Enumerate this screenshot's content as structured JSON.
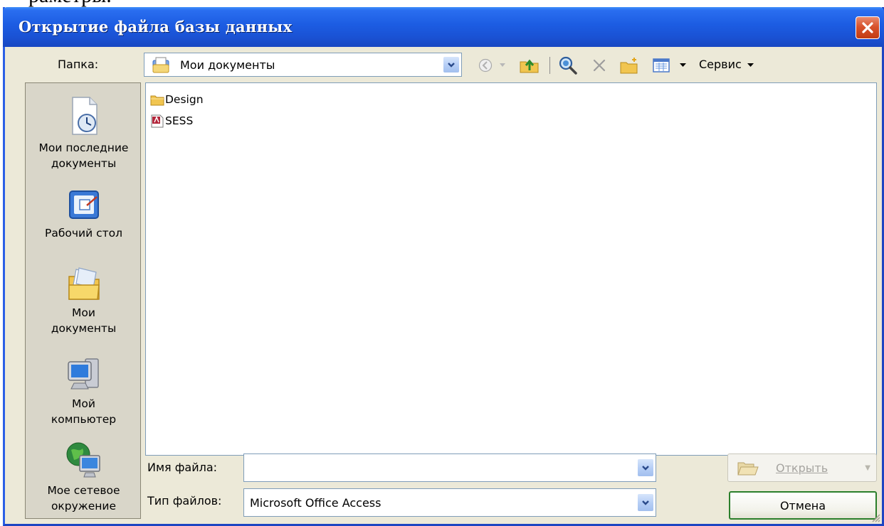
{
  "background_text": "раметры.",
  "window": {
    "title": "Открытие файла базы данных"
  },
  "toolbar": {
    "folder_label": "Папка:",
    "folder_value": "Мои документы",
    "service_label": "Сервис"
  },
  "places": [
    {
      "label_line1": "Мои последние",
      "label_line2": "документы",
      "icon": "recent-docs-icon"
    },
    {
      "label_line1": "Рабочий стол",
      "label_line2": "",
      "icon": "desktop-icon"
    },
    {
      "label_line1": "Мои",
      "label_line2": "документы",
      "icon": "my-documents-icon"
    },
    {
      "label_line1": "Мой",
      "label_line2": "компьютер",
      "icon": "my-computer-icon"
    },
    {
      "label_line1": "Мое сетевое",
      "label_line2": "окружение",
      "icon": "network-places-icon"
    }
  ],
  "files": [
    {
      "name": "Design",
      "icon": "folder-icon"
    },
    {
      "name": "SESS",
      "icon": "access-db-icon"
    }
  ],
  "bottom": {
    "filename_label": "Имя файла:",
    "filename_value": "",
    "filetype_label": "Тип файлов:",
    "filetype_value": "Microsoft Office Access",
    "open_button": "Открыть",
    "cancel_button": "Отмена"
  },
  "colors": {
    "titlebar": "#1c5ce2",
    "dialog_bg": "#ece9d8",
    "close_button": "#d8532e",
    "default_button_border": "#2b7f2b"
  }
}
